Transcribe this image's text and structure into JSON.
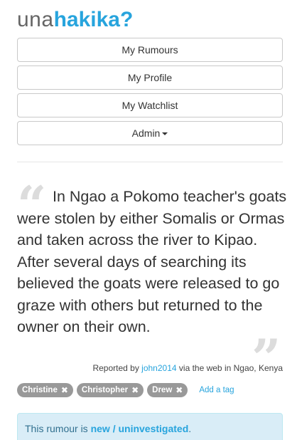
{
  "logo": {
    "light": "una",
    "bold": "hakika?"
  },
  "nav": {
    "my_rumours": "My Rumours",
    "my_profile": "My Profile",
    "my_watchlist": "My Watchlist",
    "admin": "Admin"
  },
  "rumour": {
    "text": "In Ngao a Pokomo teacher's goats were stolen by either Somalis or Ormas and taken across the river to Kipao. After several days of searching its believed the goats were released to go graze with others but returned to the owner on their own.",
    "reported_prefix": "Reported by",
    "reporter": "john2014",
    "reported_suffix": "via the web in Ngao, Kenya"
  },
  "tags": [
    "Christine",
    "Christopher",
    "Drew"
  ],
  "add_tag_label": "Add a tag",
  "status": {
    "prefix": "This rumour is",
    "value": "new / uninvestigated",
    "suffix": "."
  },
  "colors": {
    "accent": "#27a4dd",
    "tag_bg": "#999999",
    "status_bg": "#d9edf7"
  },
  "icons": {
    "tag_remove": "close-icon",
    "admin_caret": "caret-down-icon",
    "quotes": "quote-icon"
  }
}
